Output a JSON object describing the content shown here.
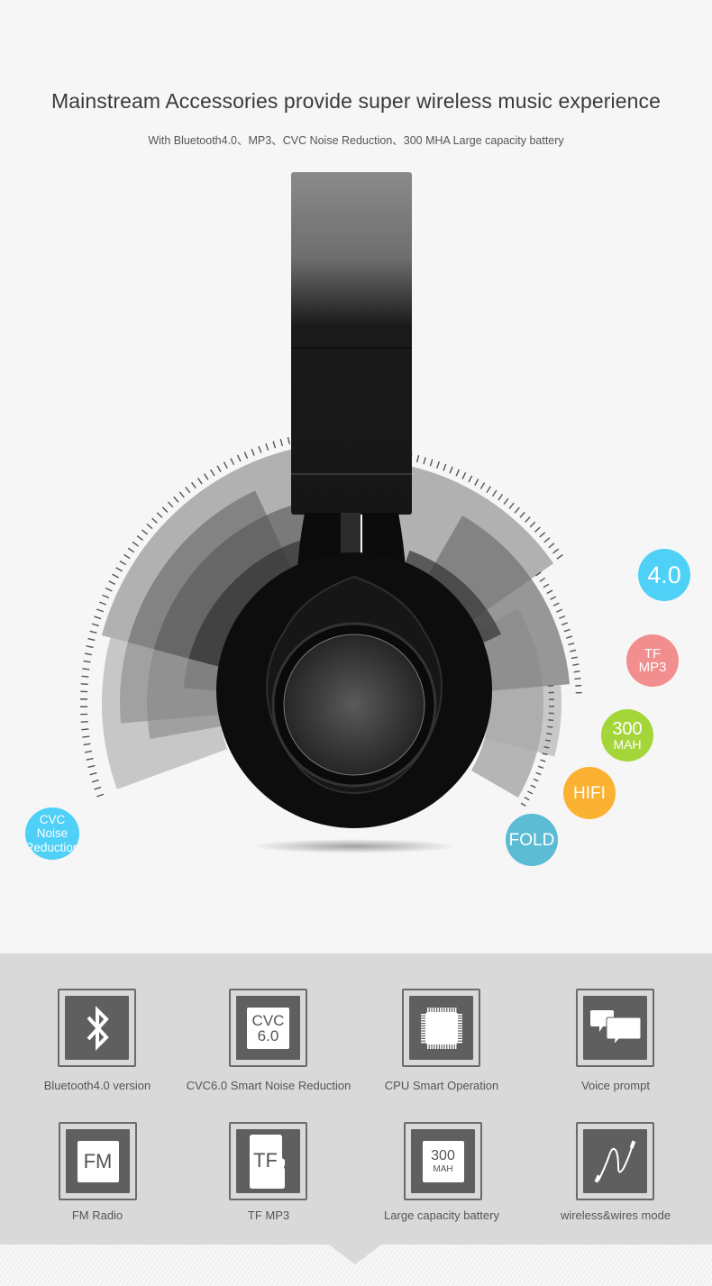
{
  "hero": {
    "headline": "Mainstream Accessories provide super wireless music experience",
    "subline": "With Bluetooth4.0、MP3、CVC Noise Reduction、300 MHA Large capacity battery",
    "product": "black over-ear wireless headphones, side view"
  },
  "bubbles": [
    {
      "id": "bt40",
      "lines": [
        "4.0"
      ],
      "color": "#4fd0f6"
    },
    {
      "id": "tfmp3",
      "lines": [
        "TF",
        "MP3"
      ],
      "color": "#f28e8e"
    },
    {
      "id": "battery",
      "lines": [
        "300",
        "MAH"
      ],
      "color": "#a4d63a"
    },
    {
      "id": "hifi",
      "lines": [
        "HIFI"
      ],
      "color": "#fbb131"
    },
    {
      "id": "fold",
      "lines": [
        "FOLD"
      ],
      "color": "#5bbcd4"
    },
    {
      "id": "cvc",
      "lines": [
        "CVC",
        "Noise",
        "Reduction"
      ],
      "color": "#4fd0f6"
    }
  ],
  "features": [
    {
      "icon": "bluetooth-icon",
      "label": "Bluetooth4.0 version"
    },
    {
      "icon": "cvc-icon",
      "label": "CVC6.0 Smart Noise Reduction",
      "tile": [
        "CVC",
        "6.0"
      ]
    },
    {
      "icon": "cpu-chip-icon",
      "label": "CPU Smart Operation"
    },
    {
      "icon": "speech-bubbles-icon",
      "label": "Voice prompt"
    },
    {
      "icon": "fm-radio-icon",
      "label": "FM Radio",
      "tile": [
        "FM"
      ]
    },
    {
      "icon": "tf-card-icon",
      "label": "TF MP3",
      "tile": [
        "TF"
      ]
    },
    {
      "icon": "battery-icon",
      "label": "Large capacity battery",
      "tile": [
        "300",
        "MAH"
      ]
    },
    {
      "icon": "audio-cable-icon",
      "label": "wireless&wires mode"
    }
  ],
  "colors": {
    "page_bg": "#f6f6f6",
    "panel_bg": "#d9d9d9",
    "icon_fill": "#5f5f5f",
    "text_dark": "#3a3a3a"
  }
}
